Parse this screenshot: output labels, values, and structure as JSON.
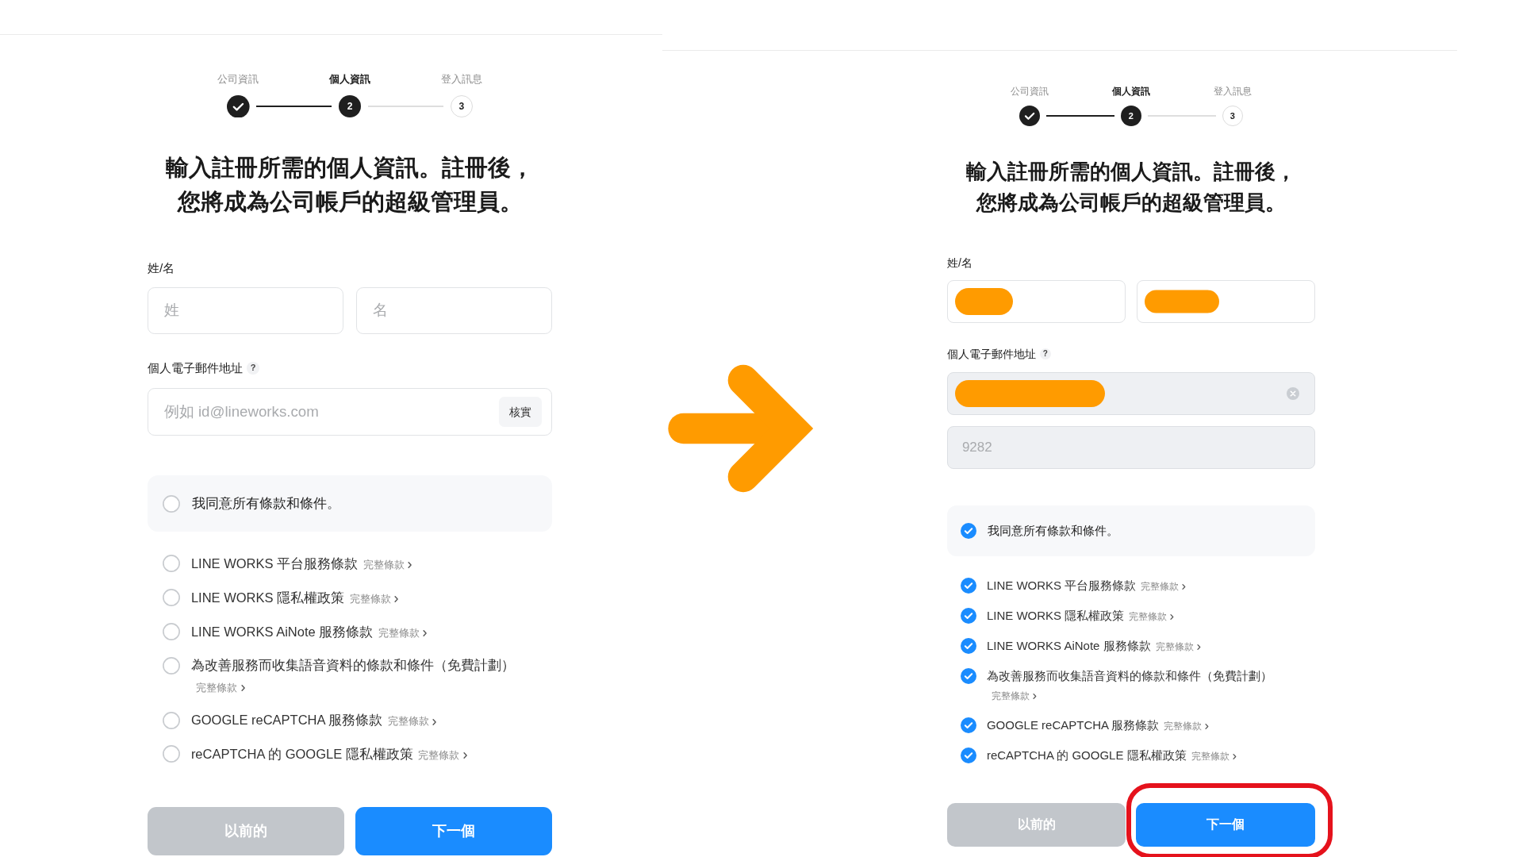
{
  "panels": [
    {
      "steps": [
        {
          "label": "公司資訊",
          "completed": true,
          "selected": false
        },
        {
          "label": "個人資訊",
          "completed": false,
          "selected": true,
          "number": "2"
        },
        {
          "label": "登入訊息",
          "completed": false,
          "selected": false,
          "number": "3"
        }
      ],
      "heading_lines": [
        "輸入註冊所需的個人資訊。註冊後，",
        "您將成為公司帳戶的超級管理員。"
      ],
      "name_label": "姓/名",
      "name_fields": [
        {
          "placeholder": "姓",
          "redacted": false
        },
        {
          "placeholder": "名",
          "redacted": false
        }
      ],
      "email_label": "個人電子郵件地址",
      "email_help": "?",
      "email": {
        "placeholder": "例如 id@lineworks.com",
        "redacted": false,
        "disabled": false,
        "clearable": false,
        "verify_button": "核實"
      },
      "agree_all": {
        "label": "我同意所有條款和條件。",
        "checked": false
      },
      "terms": [
        {
          "label": "LINE WORKS 平台服務條款",
          "link": "完整條款",
          "checked": false
        },
        {
          "label": "LINE WORKS 隱私權政策",
          "link": "完整條款",
          "checked": false
        },
        {
          "label": "LINE WORKS AiNote 服務條款",
          "link": "完整條款",
          "checked": false
        },
        {
          "label": "為改善服務而收集語音資料的條款和條件（免費計劃）",
          "link": "完整條款",
          "checked": false
        },
        {
          "label": "GOOGLE reCAPTCHA 服務條款",
          "link": "完整條款",
          "checked": false
        },
        {
          "label": "reCAPTCHA 的 GOOGLE 隱私權政策",
          "link": "完整條款",
          "checked": false
        }
      ],
      "buttons": [
        {
          "label": "以前的",
          "kind": "secondary",
          "highlighted": false
        },
        {
          "label": "下一個",
          "kind": "primary",
          "highlighted": false
        }
      ]
    },
    {
      "steps": [
        {
          "label": "公司資訊",
          "completed": true,
          "selected": false
        },
        {
          "label": "個人資訊",
          "completed": false,
          "selected": true,
          "number": "2"
        },
        {
          "label": "登入訊息",
          "completed": false,
          "selected": false,
          "number": "3"
        }
      ],
      "heading_lines": [
        "輸入註冊所需的個人資訊。註冊後，",
        "您將成為公司帳戶的超級管理員。"
      ],
      "name_label": "姓/名",
      "name_fields": [
        {
          "redacted": true
        },
        {
          "redacted": true
        }
      ],
      "email_label": "個人電子郵件地址",
      "email_help": "?",
      "email": {
        "redacted": true,
        "disabled": true,
        "clearable": true
      },
      "code_field": {
        "placeholder": "9282",
        "disabled": true
      },
      "agree_all": {
        "label": "我同意所有條款和條件。",
        "checked": true
      },
      "terms": [
        {
          "label": "LINE WORKS 平台服務條款",
          "link": "完整條款",
          "checked": true
        },
        {
          "label": "LINE WORKS 隱私權政策",
          "link": "完整條款",
          "checked": true
        },
        {
          "label": "LINE WORKS AiNote 服務條款",
          "link": "完整條款",
          "checked": true
        },
        {
          "label": "為改善服務而收集語音資料的條款和條件（免費計劃）",
          "link": "完整條款",
          "checked": true
        },
        {
          "label": "GOOGLE reCAPTCHA 服務條款",
          "link": "完整條款",
          "checked": true
        },
        {
          "label": "reCAPTCHA 的 GOOGLE 隱私權政策",
          "link": "完整條款",
          "checked": true
        }
      ],
      "buttons": [
        {
          "label": "以前的",
          "kind": "secondary",
          "highlighted": false
        },
        {
          "label": "下一個",
          "kind": "primary",
          "highlighted": true
        }
      ]
    }
  ]
}
